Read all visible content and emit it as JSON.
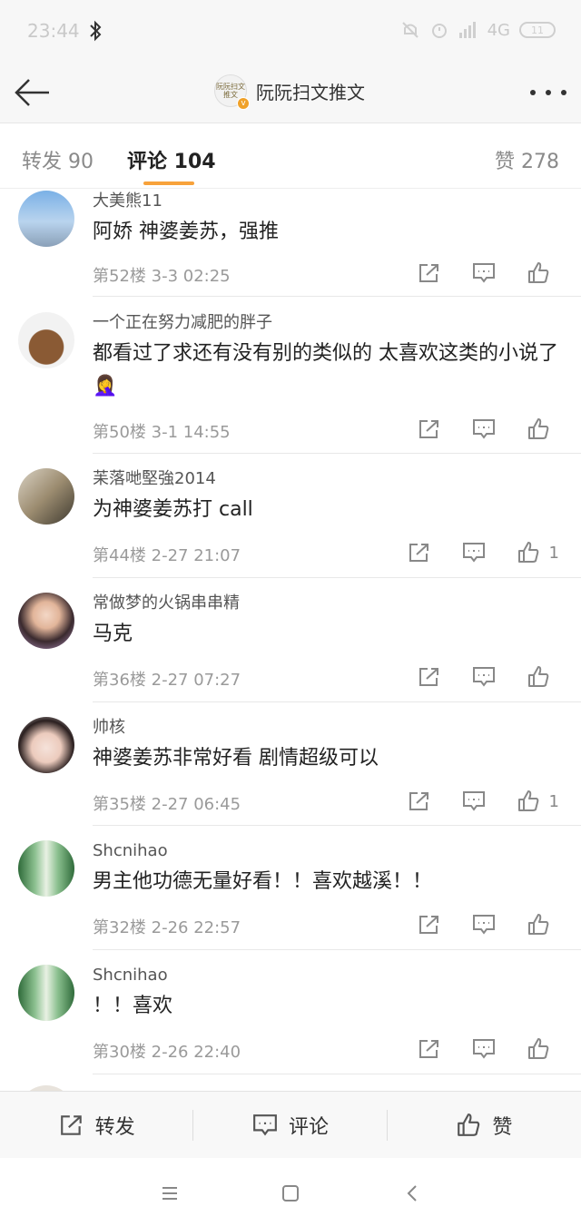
{
  "status_bar": {
    "time": "23:44",
    "network": "4G",
    "battery": "11"
  },
  "header": {
    "account_name": "阮阮扫文推文",
    "avatar_text": "阮阮扫文推文",
    "verified_badge": "v"
  },
  "tabs": [
    {
      "label": "转发 90"
    },
    {
      "label": "评论 104"
    },
    {
      "label": "赞 278"
    }
  ],
  "comments": [
    {
      "name": "大美熊11",
      "text": "阿娇 神婆姜苏，强推",
      "meta": "第52楼 3-3 02:25",
      "likes": ""
    },
    {
      "name": "一个正在努力减肥的胖子",
      "text": "都看过了求还有没有别的类似的 太喜欢这类的小说了🤦‍♀️",
      "meta": "第50楼 3-1 14:55",
      "likes": ""
    },
    {
      "name": "苿落哋堅強2014",
      "text": "为神婆姜苏打 call",
      "meta": "第44楼 2-27 21:07",
      "likes": "1"
    },
    {
      "name": "常做梦的火锅串串精",
      "text": "马克",
      "meta": "第36楼 2-27 07:27",
      "likes": ""
    },
    {
      "name": "帅核",
      "text": "神婆姜苏非常好看 剧情超级可以",
      "meta": "第35楼 2-27 06:45",
      "likes": "1"
    },
    {
      "name": "Shcnihao",
      "text": "男主他功德无量好看！！喜欢越溪！！",
      "meta": "第32楼 2-26 22:57",
      "likes": ""
    },
    {
      "name": "Shcnihao",
      "text": "！！喜欢",
      "meta": "第30楼 2-26 22:40",
      "likes": ""
    }
  ],
  "action_bar": {
    "repost": "转发",
    "comment": "评论",
    "like": "赞"
  },
  "colors": {
    "accent": "#f7a23b",
    "badge": "#f0a128"
  }
}
